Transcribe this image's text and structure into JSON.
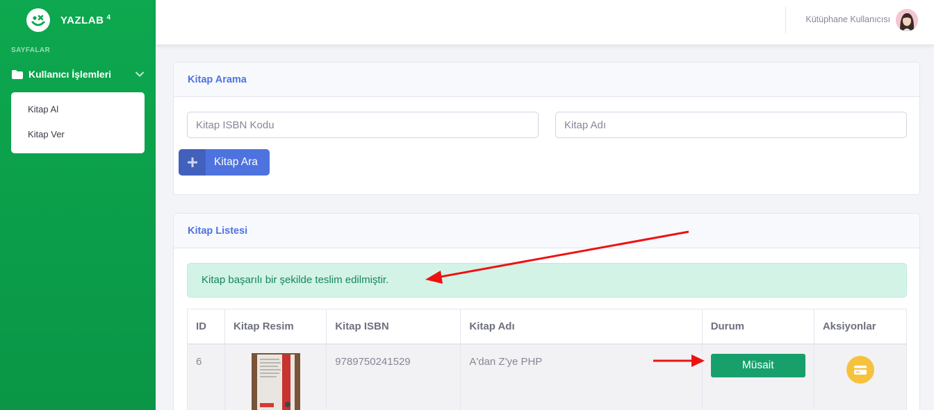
{
  "sidebar": {
    "brand": "YAZLAB",
    "brand_sup": "4",
    "heading": "SAYFALAR",
    "nav_label": "Kullanıcı İşlemleri",
    "submenu": [
      "Kitap Al",
      "Kitap Ver"
    ]
  },
  "topbar": {
    "user_name": "Kütüphane Kullanıcısı"
  },
  "search_card": {
    "title": "Kitap Arama",
    "isbn_placeholder": "Kitap ISBN Kodu",
    "name_placeholder": "Kitap Adı",
    "button_label": "Kitap Ara"
  },
  "list_card": {
    "title": "Kitap Listesi",
    "alert": "Kitap başarılı bir şekilde teslim edilmiştir.",
    "columns": [
      "ID",
      "Kitap Resim",
      "Kitap ISBN",
      "Kitap Adı",
      "Durum",
      "Aksiyonlar"
    ],
    "rows": [
      {
        "id": "6",
        "isbn": "9789750241529",
        "name": "A'dan Z'ye PHP",
        "status": "Müsait"
      }
    ]
  },
  "colors": {
    "sidebar": "#0da84f",
    "primary": "#4e73df",
    "success": "#18a06c",
    "warning": "#f6c23e",
    "annotation_arrow": "#ee1111"
  }
}
